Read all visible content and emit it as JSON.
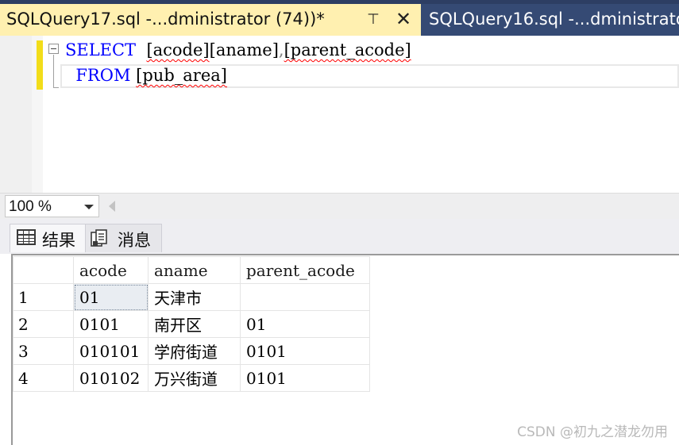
{
  "tabs": {
    "active": {
      "title": "SQLQuery17.sql -...dministrator (74))*"
    },
    "inactive": {
      "title": "SQLQuery16.sql -...dministrator"
    }
  },
  "editor": {
    "line1": {
      "keyword": "SELECT",
      "col1": "[acode]",
      "col2": "[aname]",
      "comma": ",",
      "col3": "[parent_acode]"
    },
    "line2": {
      "keyword": "FROM",
      "table": "[pub_area]"
    }
  },
  "zoom": {
    "value": "100 %"
  },
  "result_tabs": [
    {
      "label": "结果",
      "icon": "grid-icon"
    },
    {
      "label": "消息",
      "icon": "message-icon"
    }
  ],
  "results": {
    "columns": [
      "acode",
      "aname",
      "parent_acode"
    ],
    "rows": [
      {
        "num": "1",
        "acode": "01",
        "aname": "天津市",
        "parent_acode": ""
      },
      {
        "num": "2",
        "acode": "0101",
        "aname": "南开区",
        "parent_acode": "01"
      },
      {
        "num": "3",
        "acode": "010101",
        "aname": "学府街道",
        "parent_acode": "0101"
      },
      {
        "num": "4",
        "acode": "010102",
        "aname": "万兴街道",
        "parent_acode": "0101"
      }
    ]
  },
  "watermark": "CSDN @初九之潜龙勿用",
  "colors": {
    "tab_active_bg": "#fff0b0",
    "tab_bar_bg": "#2d3e63",
    "keyword": "#0000ff",
    "error_squiggle": "#ff0000",
    "modified_margin": "#ffe000"
  }
}
